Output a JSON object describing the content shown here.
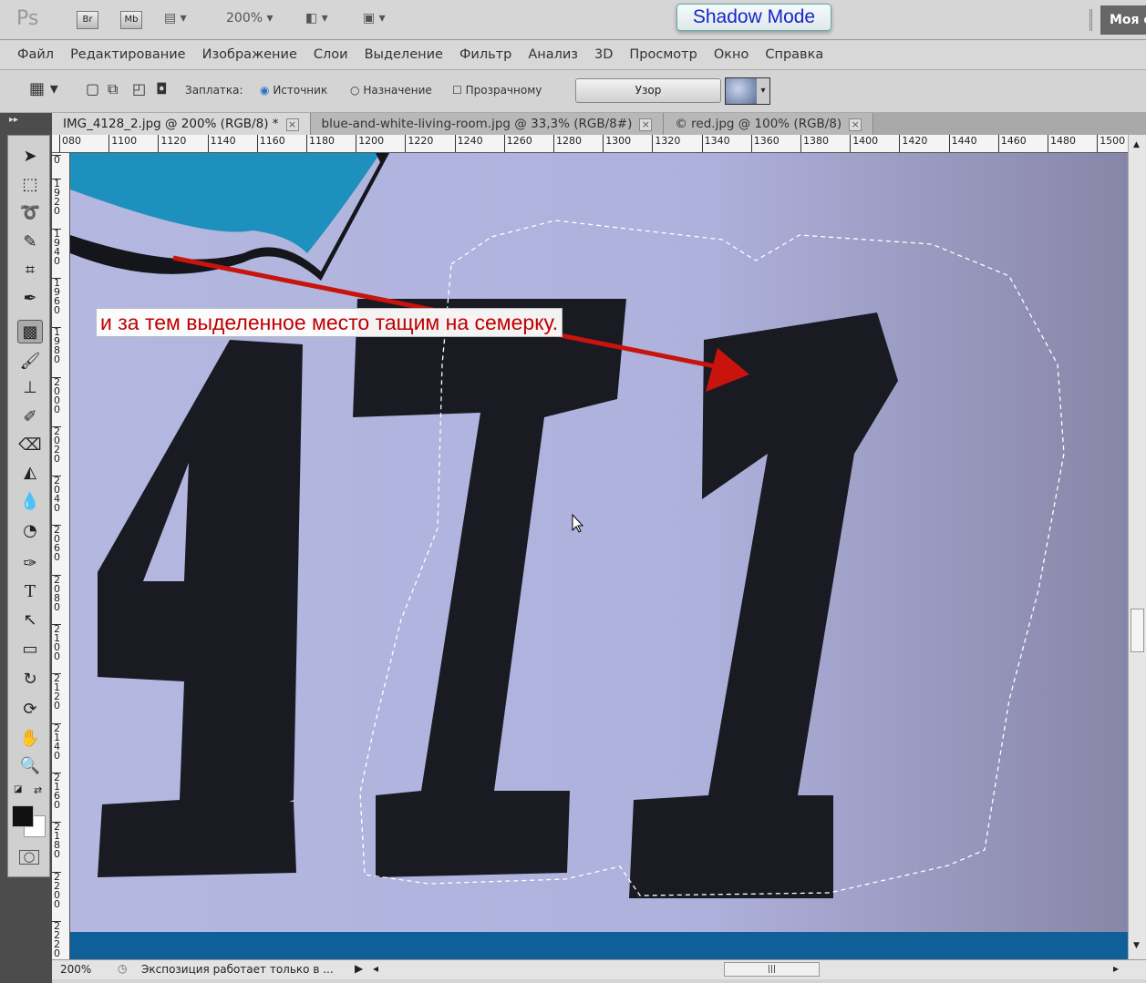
{
  "appbar": {
    "logo": "Ps",
    "bridge": "Br",
    "minibridge": "Mb",
    "zoom": "200%",
    "shadow_mode": "Shadow Mode",
    "workspace": "Моя среда"
  },
  "menu": [
    "Файл",
    "Редактирование",
    "Изображение",
    "Слои",
    "Выделение",
    "Фильтр",
    "Анализ",
    "3D",
    "Просмотр",
    "Окно",
    "Справка"
  ],
  "options": {
    "patch_label": "Заплатка:",
    "source": "Источник",
    "destination": "Назначение",
    "transparent": "Прозрачному",
    "pattern_button": "Узор",
    "source_selected": true,
    "transparent_checked": false
  },
  "tabs": [
    {
      "label": "IMG_4128_2.jpg @ 200% (RGB/8) *",
      "active": true
    },
    {
      "label": "blue-and-white-living-room.jpg @ 33,3% (RGB/8#)",
      "active": false
    },
    {
      "label": "© red.jpg @ 100% (RGB/8)",
      "active": false
    }
  ],
  "hruler": [
    "080",
    "1100",
    "1120",
    "1140",
    "1160",
    "1180",
    "1200",
    "1220",
    "1240",
    "1260",
    "1280",
    "1300",
    "1320",
    "1340",
    "1360",
    "1380",
    "1400",
    "1420",
    "1440",
    "1460",
    "1480",
    "1500"
  ],
  "vruler": [
    "0",
    "1920",
    "1940",
    "1960",
    "1980",
    "2000",
    "2020",
    "2040",
    "2060",
    "2080",
    "2100",
    "2120",
    "2140",
    "2160",
    "2180",
    "2200",
    "2220"
  ],
  "tools": [
    "move",
    "rectangular-marquee",
    "lasso",
    "quick-selection",
    "crop",
    "eyedropper",
    "patch",
    "brush",
    "clone-stamp",
    "history-brush",
    "eraser",
    "paint-bucket",
    "blur",
    "dodge",
    "pen",
    "type",
    "path-selection",
    "rectangle",
    "3d-rotate",
    "3d-orbit",
    "hand",
    "zoom"
  ],
  "annotation": "и за тем выделенное место тащим на семерку.",
  "status": {
    "zoom": "200%",
    "info": "Экспозиция работает только в ..."
  },
  "colors": {
    "foreground": "#111111",
    "background": "#ffffff",
    "annotation": "#c00000"
  }
}
